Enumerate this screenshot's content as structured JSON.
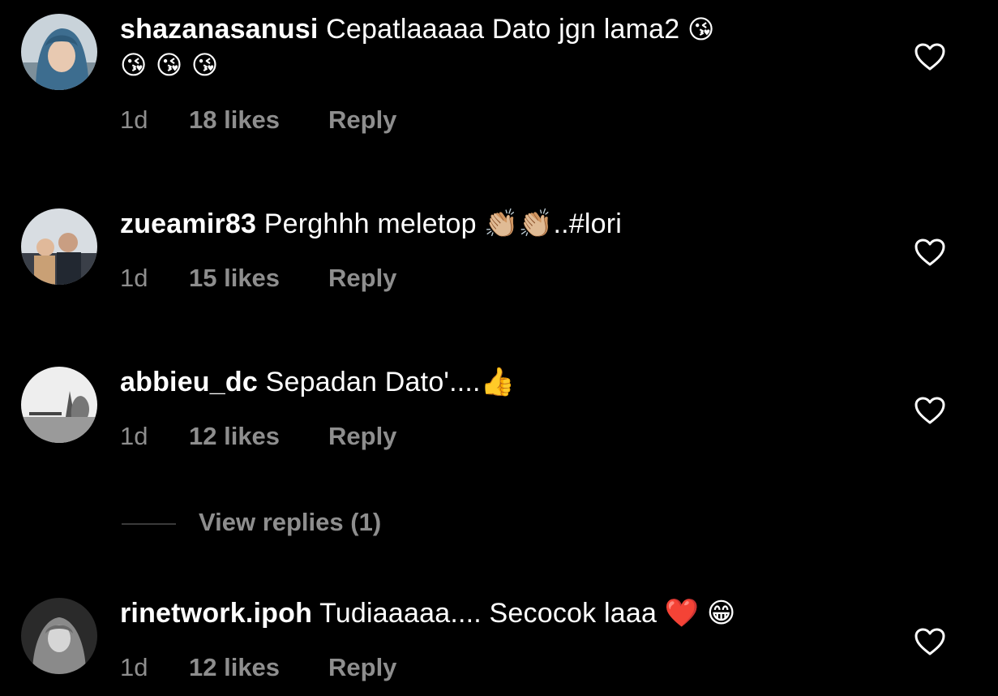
{
  "comments": [
    {
      "username": "shazanasanusi",
      "text": "Cepatlaaaaa Dato jgn lama2",
      "emoji_line": "😘 😘 😘",
      "emoji_inline": "😘",
      "time": "1d",
      "likes": "18 likes",
      "reply": "Reply",
      "avatar": "avatar-hijab-woman"
    },
    {
      "username": "zueamir83",
      "text": "Perghhh meletop 👏🏼👏🏼..#lori",
      "time": "1d",
      "likes": "15 likes",
      "reply": "Reply",
      "avatar": "avatar-family-photo"
    },
    {
      "username": "abbieu_dc",
      "text": "Sepadan Dato'....👍",
      "time": "1d",
      "likes": "12 likes",
      "reply": "Reply",
      "avatar": "avatar-landscape-bw"
    },
    {
      "username": "rinetwork.ipoh",
      "text": "Tudiaaaaa.... Secocok laaa ❤️ 😁",
      "time": "1d",
      "likes": "12 likes",
      "reply": "Reply",
      "avatar": "avatar-hijab-bw"
    }
  ],
  "view_replies": "View replies (1)",
  "icons": {
    "like": "heart-outline-icon"
  },
  "colors": {
    "background": "#000000",
    "text": "#ffffff",
    "muted": "#8e8e8e"
  }
}
